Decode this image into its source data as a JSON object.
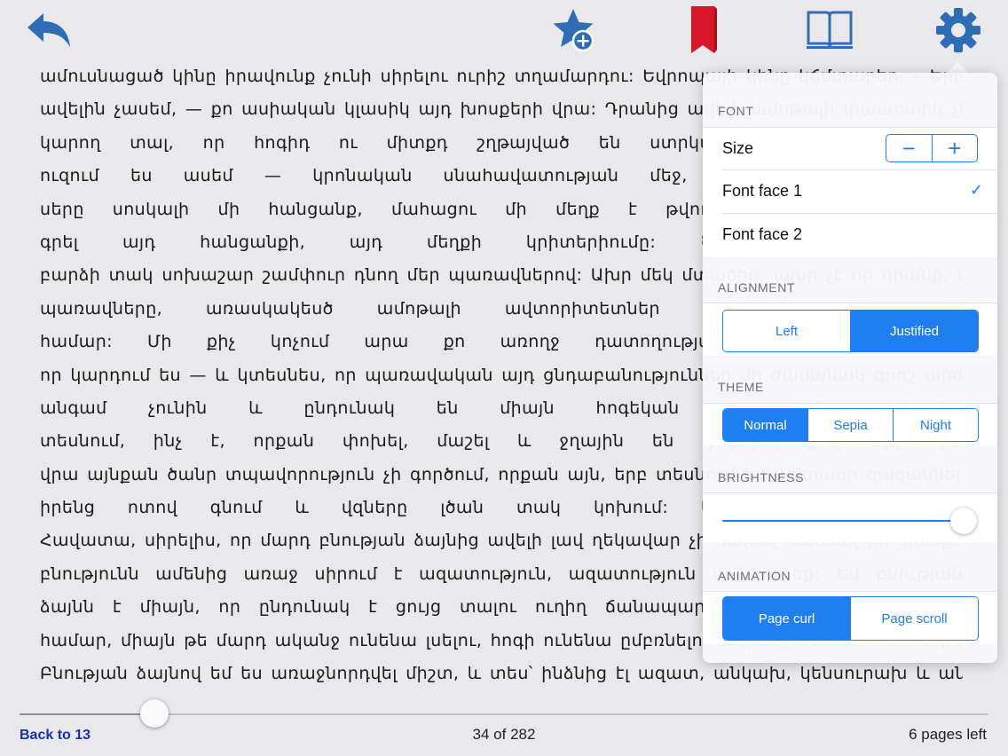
{
  "toolbar": {
    "icons": [
      "back-arrow-icon",
      "star-add-icon",
      "bookmark-icon",
      "book-icon",
      "gear-icon"
    ],
    "accent": "#2f6db5",
    "bookmark_color": "#d9172b"
  },
  "text": {
    "lines": [
      "ամուսնացած կինը իրավունք չունի սիրելու ուրիշ տղամարդու: Եվրոպայի կինը կճմտաբեր, – Երբ",
      "ավելին չասեմ, — քո ասիական կլասիկ այդ խոսքերի վրա: Դրանից ավելի ամոթալի փաստարկ չէիր",
      "կարող տալ, որ հոգիդ ու միտքդ շղթայված են ստրկական կյանքի և բուն",
      "ուզում ես ասեմ — կրոնական սնահավատության մեջ, որից դուրս ամենևին",
      "սերը սոսկալի մի հանցանք, մահացու մի մեղք է թվում քեզ: Ինչ հանցանք",
      "գրել այդ հանցանքի, այդ մեղքի կրիտերիումը: Ծննդաբեր կնոջ գլխ",
      "բարձի տակ սոխաշար շամփուր դնող մեր պառավներով: Ախր մեկ մտածիր, ախր չէ որ դրանք, այդ",
      "պառավները, առասկակեսծ ամոթալի ավտորիտետներ են քեզ պես կրթ",
      "համար: Մի քիչ կոչում արա քո առողջ դատողությանը, այն կրթությունը,",
      "որ կարդում ես — և կտեսնես, որ պառավական այդ ցնդաբանություններ մի ժամանակ գրոշ արժեց",
      "անգամ չունին և ընդունակ են միայն հոգեկան ապարդյուն տանջանք",
      "տեսնում, ինչ է, որքան փոխել, մաշել և ջղային են դարձրել քեզ այդ հիմ",
      "վրա այնքան ծանր տպավորություն չի գործում, որքան այն, երբ տեսնում եմ անտառի գազանները",
      "իրենց ոտով գնում և վզները լծան տակ կոխում: Այդպիսի տպավորություն",
      "Հավատա, սիրելիս, որ մարդ բնության ձայնից ավելի լավ ղեկավար չի կարող ունենալ իր կյանքում:",
      "բնությունն ամենից առաջ սիրում է ազատություն, ազատություն ամենուրեք: Եվ բնության",
      "ձայնն է միայն, որ ընդունակ է ցույց տալու ուղիղ ճանապարհը տարակուսած մարդու",
      "համար, միայն թե մարդ ականջ ունենա լսելու, հոգի ունենա ըմբռնելու և կամք ունենա հետևելու:",
      "Բնության ձայնով եմ ես առաջնորդվել միշտ, և տես՝ ինձնից էլ ազատ, անկախ, կենսուրախ և անհոգ"
    ]
  },
  "footer": {
    "back_link": "Back to 13",
    "page_count": "34 of 282",
    "pages_left": "6 pages left",
    "progress": 0.139
  },
  "settings": {
    "font_header": "FONT",
    "size_label": "Size",
    "size_minus": "−",
    "size_plus": "+",
    "font_face_1": "Font face 1",
    "font_face_2": "Font face 2",
    "selected_font": "Font face 1",
    "checkmark": "✓",
    "alignment_header": "ALIGNMENT",
    "align_left": "Left",
    "align_justified": "Justified",
    "selected_alignment": "Justified",
    "theme_header": "THEME",
    "theme_normal": "Normal",
    "theme_sepia": "Sepia",
    "theme_night": "Night",
    "selected_theme": "Normal",
    "brightness_header": "BRIGHTNESS",
    "brightness": 1.0,
    "animation_header": "ANIMATION",
    "anim_curl": "Page curl",
    "anim_scroll": "Page scroll",
    "selected_animation": "Page curl",
    "accent": "#1f7ef0"
  }
}
